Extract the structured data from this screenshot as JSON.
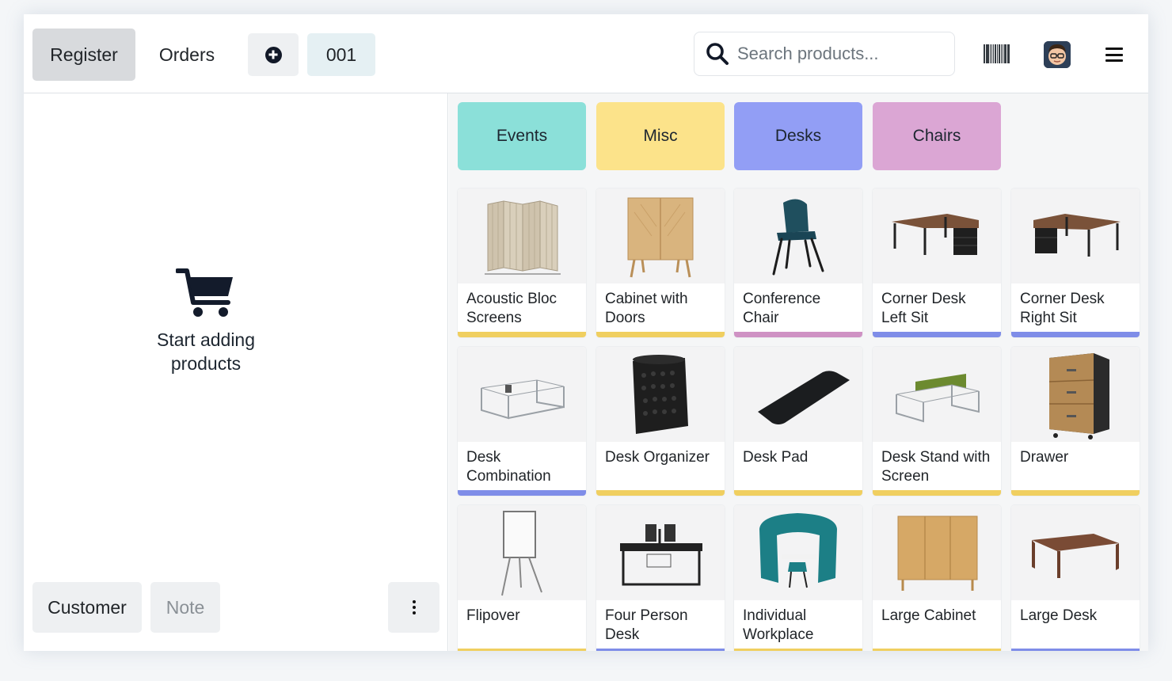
{
  "colors": {
    "events": "#8be0d9",
    "misc": "#fce38a",
    "desks": "#929ef5",
    "chairs": "#dba6d4"
  },
  "header": {
    "register_label": "Register",
    "orders_label": "Orders",
    "add_order_icon": "plus-circle-icon",
    "order_number": "001",
    "search_placeholder": "Search products...",
    "barcode_icon": "barcode-icon",
    "menu_icon": "hamburger-menu-icon"
  },
  "cart": {
    "empty_line1": "Start adding",
    "empty_line2": "products",
    "customer_label": "Customer",
    "note_label": "Note"
  },
  "categories": [
    {
      "label": "Events",
      "color": "#8be0d9"
    },
    {
      "label": "Misc",
      "color": "#fce38a"
    },
    {
      "label": "Desks",
      "color": "#929ef5"
    },
    {
      "label": "Chairs",
      "color": "#dba6d4"
    }
  ],
  "products": [
    {
      "name": "Acoustic Bloc Screens",
      "category": "misc"
    },
    {
      "name": "Cabinet with Doors",
      "category": "misc"
    },
    {
      "name": "Conference Chair",
      "category": "chairs"
    },
    {
      "name": "Corner Desk Left Sit",
      "category": "desks"
    },
    {
      "name": "Corner Desk Right Sit",
      "category": "desks"
    },
    {
      "name": "Desk Combination",
      "category": "desks"
    },
    {
      "name": "Desk Organizer",
      "category": "misc"
    },
    {
      "name": "Desk Pad",
      "category": "misc"
    },
    {
      "name": "Desk Stand with Screen",
      "category": "misc"
    },
    {
      "name": "Drawer",
      "category": "misc"
    },
    {
      "name": "Flipover",
      "category": "misc"
    },
    {
      "name": "Four Person Desk",
      "category": "desks"
    },
    {
      "name": "Individual Workplace",
      "category": "misc"
    },
    {
      "name": "Large Cabinet",
      "category": "misc"
    },
    {
      "name": "Large Desk",
      "category": "desks"
    }
  ]
}
